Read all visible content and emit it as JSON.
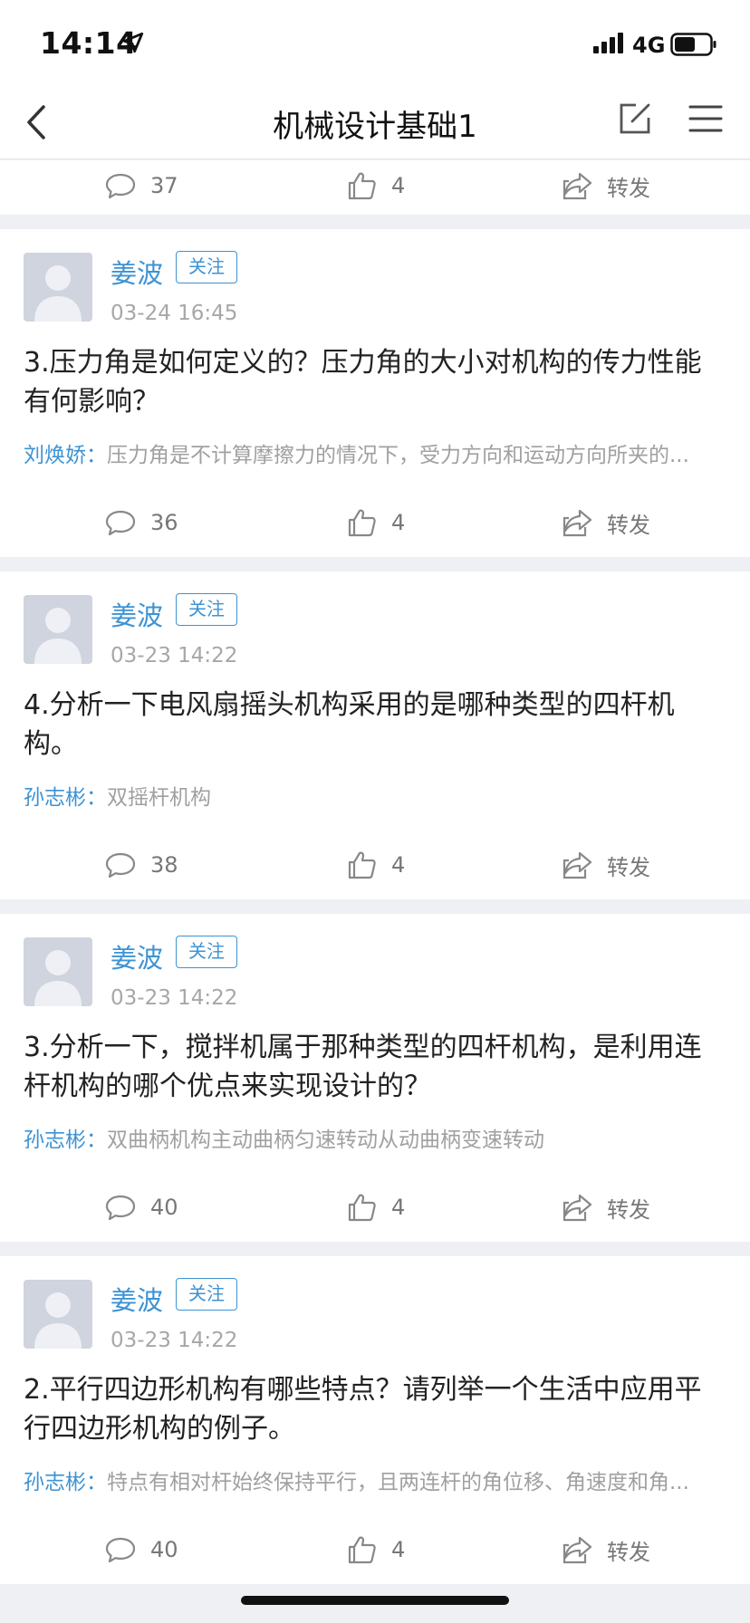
{
  "status_bar": {
    "time": "14:14",
    "network": "4G"
  },
  "nav": {
    "title": "机械设计基础1"
  },
  "top_actions": {
    "comments": "37",
    "likes": "4",
    "share": "转发"
  },
  "posts": [
    {
      "author": "姜波",
      "follow": "关注",
      "time": "03-24 16:45",
      "title": "3.压力角是如何定义的？压力角的大小对机构的传力性能有何影响？",
      "reply_name": "刘焕娇：",
      "reply_text": "压力角是不计算摩擦力的情况下，受力方向和运动方向所夹的...",
      "comments": "36",
      "likes": "4",
      "share": "转发"
    },
    {
      "author": "姜波",
      "follow": "关注",
      "time": "03-23 14:22",
      "title": "4.分析一下电风扇摇头机构采用的是哪种类型的四杆机构。",
      "reply_name": "孙志彬：",
      "reply_text": "双摇杆机构",
      "comments": "38",
      "likes": "4",
      "share": "转发"
    },
    {
      "author": "姜波",
      "follow": "关注",
      "time": "03-23 14:22",
      "title": "3.分析一下，搅拌机属于那种类型的四杆机构，是利用连杆机构的哪个优点来实现设计的？",
      "reply_name": "孙志彬：",
      "reply_text": "双曲柄机构主动曲柄匀速转动从动曲柄变速转动",
      "comments": "40",
      "likes": "4",
      "share": "转发"
    },
    {
      "author": "姜波",
      "follow": "关注",
      "time": "03-23 14:22",
      "title": "2.平行四边形机构有哪些特点？请列举一个生活中应用平行四边形机构的例子。",
      "reply_name": "孙志彬：",
      "reply_text": "特点有相对杆始终保持平行，且两连杆的角位移、角速度和角...",
      "comments": "40",
      "likes": "4",
      "share": "转发"
    }
  ]
}
